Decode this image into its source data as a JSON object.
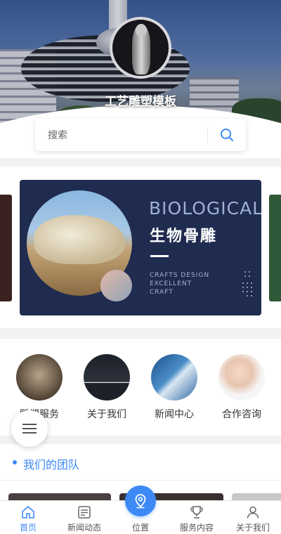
{
  "header": {
    "site_title": "工艺雕塑模板"
  },
  "search": {
    "placeholder": "搜索"
  },
  "banner": {
    "en_title": "BIOLOGICAL",
    "cn_title": "生物骨雕",
    "sub_lines": [
      "CRAFTS DESIGN",
      "EXCELLENT",
      "CRAFT"
    ]
  },
  "menu": {
    "items": [
      {
        "label": "雕塑服务"
      },
      {
        "label": "关于我们"
      },
      {
        "label": "新闻中心"
      },
      {
        "label": "合作咨询"
      }
    ]
  },
  "team": {
    "title": "我们的团队"
  },
  "bottom_nav": {
    "items": [
      {
        "label": "首页",
        "icon": "home-icon",
        "active": true
      },
      {
        "label": "新闻动态",
        "icon": "news-icon"
      },
      {
        "label": "位置",
        "icon": "location-pin-icon"
      },
      {
        "label": "服务内容",
        "icon": "trophy-icon"
      },
      {
        "label": "关于我们",
        "icon": "user-icon"
      }
    ]
  },
  "colors": {
    "accent": "#3d8af7",
    "banner_bg": "#1f2b4f"
  }
}
